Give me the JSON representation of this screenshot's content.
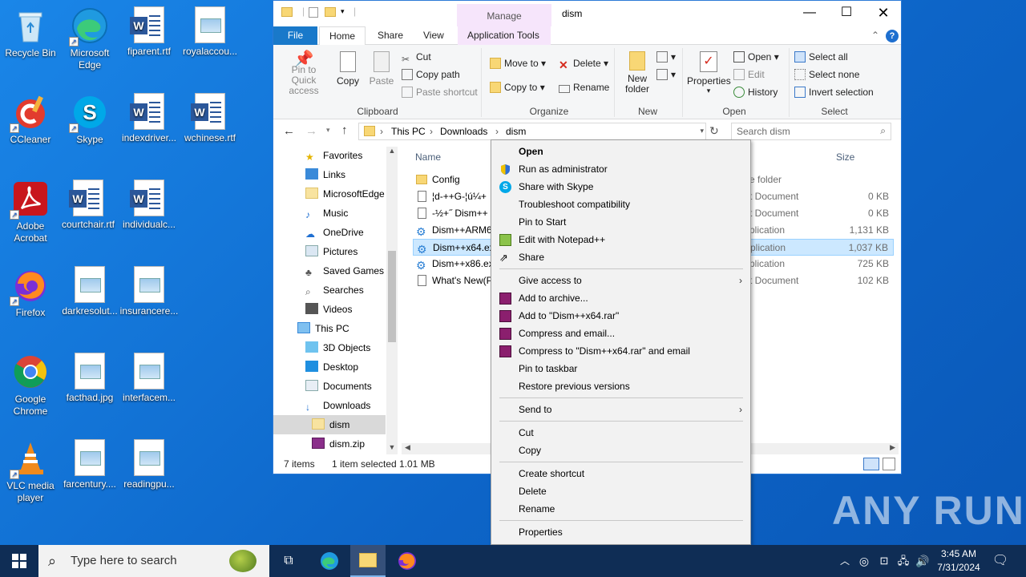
{
  "desktop": {
    "icons": [
      {
        "label": "Recycle Bin",
        "icon": "recycle-bin-icon"
      },
      {
        "label": "Microsoft Edge",
        "icon": "edge-icon"
      },
      {
        "label": "fiparent.rtf",
        "icon": "word-doc-icon"
      },
      {
        "label": "royalaccou...",
        "icon": "image-file-icon"
      },
      {
        "label": "CCleaner",
        "icon": "ccleaner-icon"
      },
      {
        "label": "Skype",
        "icon": "skype-icon"
      },
      {
        "label": "indexdriver...",
        "icon": "word-doc-icon"
      },
      {
        "label": "wchinese.rtf",
        "icon": "word-doc-icon"
      },
      {
        "label": "Adobe Acrobat",
        "icon": "acrobat-icon"
      },
      {
        "label": "courtchair.rtf",
        "icon": "word-doc-icon"
      },
      {
        "label": "individualc...",
        "icon": "word-doc-icon"
      },
      {
        "label": "Firefox",
        "icon": "firefox-icon"
      },
      {
        "label": "darkresolut...",
        "icon": "image-file-icon"
      },
      {
        "label": "insurancere...",
        "icon": "image-file-icon"
      },
      {
        "label": "Google Chrome",
        "icon": "chrome-icon"
      },
      {
        "label": "facthad.jpg",
        "icon": "image-file-icon"
      },
      {
        "label": "interfacem...",
        "icon": "image-file-icon"
      },
      {
        "label": "VLC media player",
        "icon": "vlc-icon"
      },
      {
        "label": "farcentury....",
        "icon": "image-file-icon"
      },
      {
        "label": "readingpu...",
        "icon": "image-file-icon"
      }
    ]
  },
  "explorer": {
    "title": "dism",
    "context_tab": "Manage",
    "tabs": [
      "File",
      "Home",
      "Share",
      "View",
      "Application Tools"
    ],
    "ribbon": {
      "pin": "Pin to Quick access",
      "copy": "Copy",
      "paste": "Paste",
      "cut": "Cut",
      "copy_path": "Copy path",
      "paste_shortcut": "Paste shortcut",
      "move_to": "Move to",
      "copy_to": "Copy to",
      "delete": "Delete",
      "rename": "Rename",
      "new_folder": "New folder",
      "properties": "Properties",
      "open": "Open",
      "edit": "Edit",
      "history": "History",
      "select_all": "Select all",
      "select_none": "Select none",
      "invert_selection": "Invert selection",
      "groups": [
        "Clipboard",
        "Organize",
        "New",
        "Open",
        "Select"
      ]
    },
    "address": {
      "crumbs": [
        "This PC",
        "Downloads",
        "dism"
      ],
      "search_placeholder": "Search dism"
    },
    "nav": [
      {
        "label": "Favorites",
        "icon": "star-icon"
      },
      {
        "label": "Links",
        "icon": "links-icon"
      },
      {
        "label": "MicrosoftEdge",
        "icon": "folder-icon"
      },
      {
        "label": "Music",
        "icon": "music-icon"
      },
      {
        "label": "OneDrive",
        "icon": "onedrive-icon"
      },
      {
        "label": "Pictures",
        "icon": "pictures-icon"
      },
      {
        "label": "Saved Games",
        "icon": "saved-games-icon"
      },
      {
        "label": "Searches",
        "icon": "searches-icon"
      },
      {
        "label": "Videos",
        "icon": "videos-icon"
      },
      {
        "label": "This PC",
        "icon": "computer-icon"
      },
      {
        "label": "3D Objects",
        "icon": "objects-3d-icon"
      },
      {
        "label": "Desktop",
        "icon": "desktop-icon"
      },
      {
        "label": "Documents",
        "icon": "documents-icon"
      },
      {
        "label": "Downloads",
        "icon": "downloads-icon"
      },
      {
        "label": "dism",
        "icon": "folder-icon"
      },
      {
        "label": "dism.zip",
        "icon": "zip-icon"
      }
    ],
    "columns": {
      "name": "Name",
      "size": "Size"
    },
    "files": [
      {
        "name": "Config",
        "type": "e folder",
        "size": ""
      },
      {
        "name": "¦d-++G-¦ú¼+",
        "type": "t Document",
        "size": "0 KB"
      },
      {
        "name": "-½+˝ Dism++",
        "type": "t Document",
        "size": "0 KB"
      },
      {
        "name": "Dism++ARM6",
        "type": "plication",
        "size": "1,131 KB"
      },
      {
        "name": "Dism++x64.ex",
        "type": "plication",
        "size": "1,037 KB"
      },
      {
        "name": "Dism++x86.ex",
        "type": "plication",
        "size": "725 KB"
      },
      {
        "name": "What's New(P",
        "type": "t Document",
        "size": "102 KB"
      }
    ],
    "status": {
      "count": "7 items",
      "selected": "1 item selected",
      "size": "1.01 MB"
    }
  },
  "context_menu": {
    "items": [
      {
        "label": "Open",
        "bold": true
      },
      {
        "label": "Run as administrator",
        "icon": "shield-icon"
      },
      {
        "label": "Share with Skype",
        "icon": "skype-icon"
      },
      {
        "label": "Troubleshoot compatibility"
      },
      {
        "label": "Pin to Start"
      },
      {
        "label": "Edit with Notepad++",
        "icon": "notepadpp-icon"
      },
      {
        "label": "Share",
        "icon": "share-icon"
      },
      {
        "label": "Give access to",
        "submenu": true
      },
      {
        "label": "Add to archive...",
        "icon": "winrar-icon"
      },
      {
        "label": "Add to \"Dism++x64.rar\"",
        "icon": "winrar-icon"
      },
      {
        "label": "Compress and email...",
        "icon": "winrar-icon"
      },
      {
        "label": "Compress to \"Dism++x64.rar\" and email",
        "icon": "winrar-icon"
      },
      {
        "label": "Pin to taskbar"
      },
      {
        "label": "Restore previous versions"
      },
      {
        "label": "Send to",
        "submenu": true
      },
      {
        "label": "Cut"
      },
      {
        "label": "Copy"
      },
      {
        "label": "Create shortcut"
      },
      {
        "label": "Delete"
      },
      {
        "label": "Rename"
      },
      {
        "label": "Properties"
      }
    ]
  },
  "taskbar": {
    "search_placeholder": "Type here to search",
    "time": "3:45 AM",
    "date": "7/31/2024"
  },
  "watermark": "ANY RUN"
}
